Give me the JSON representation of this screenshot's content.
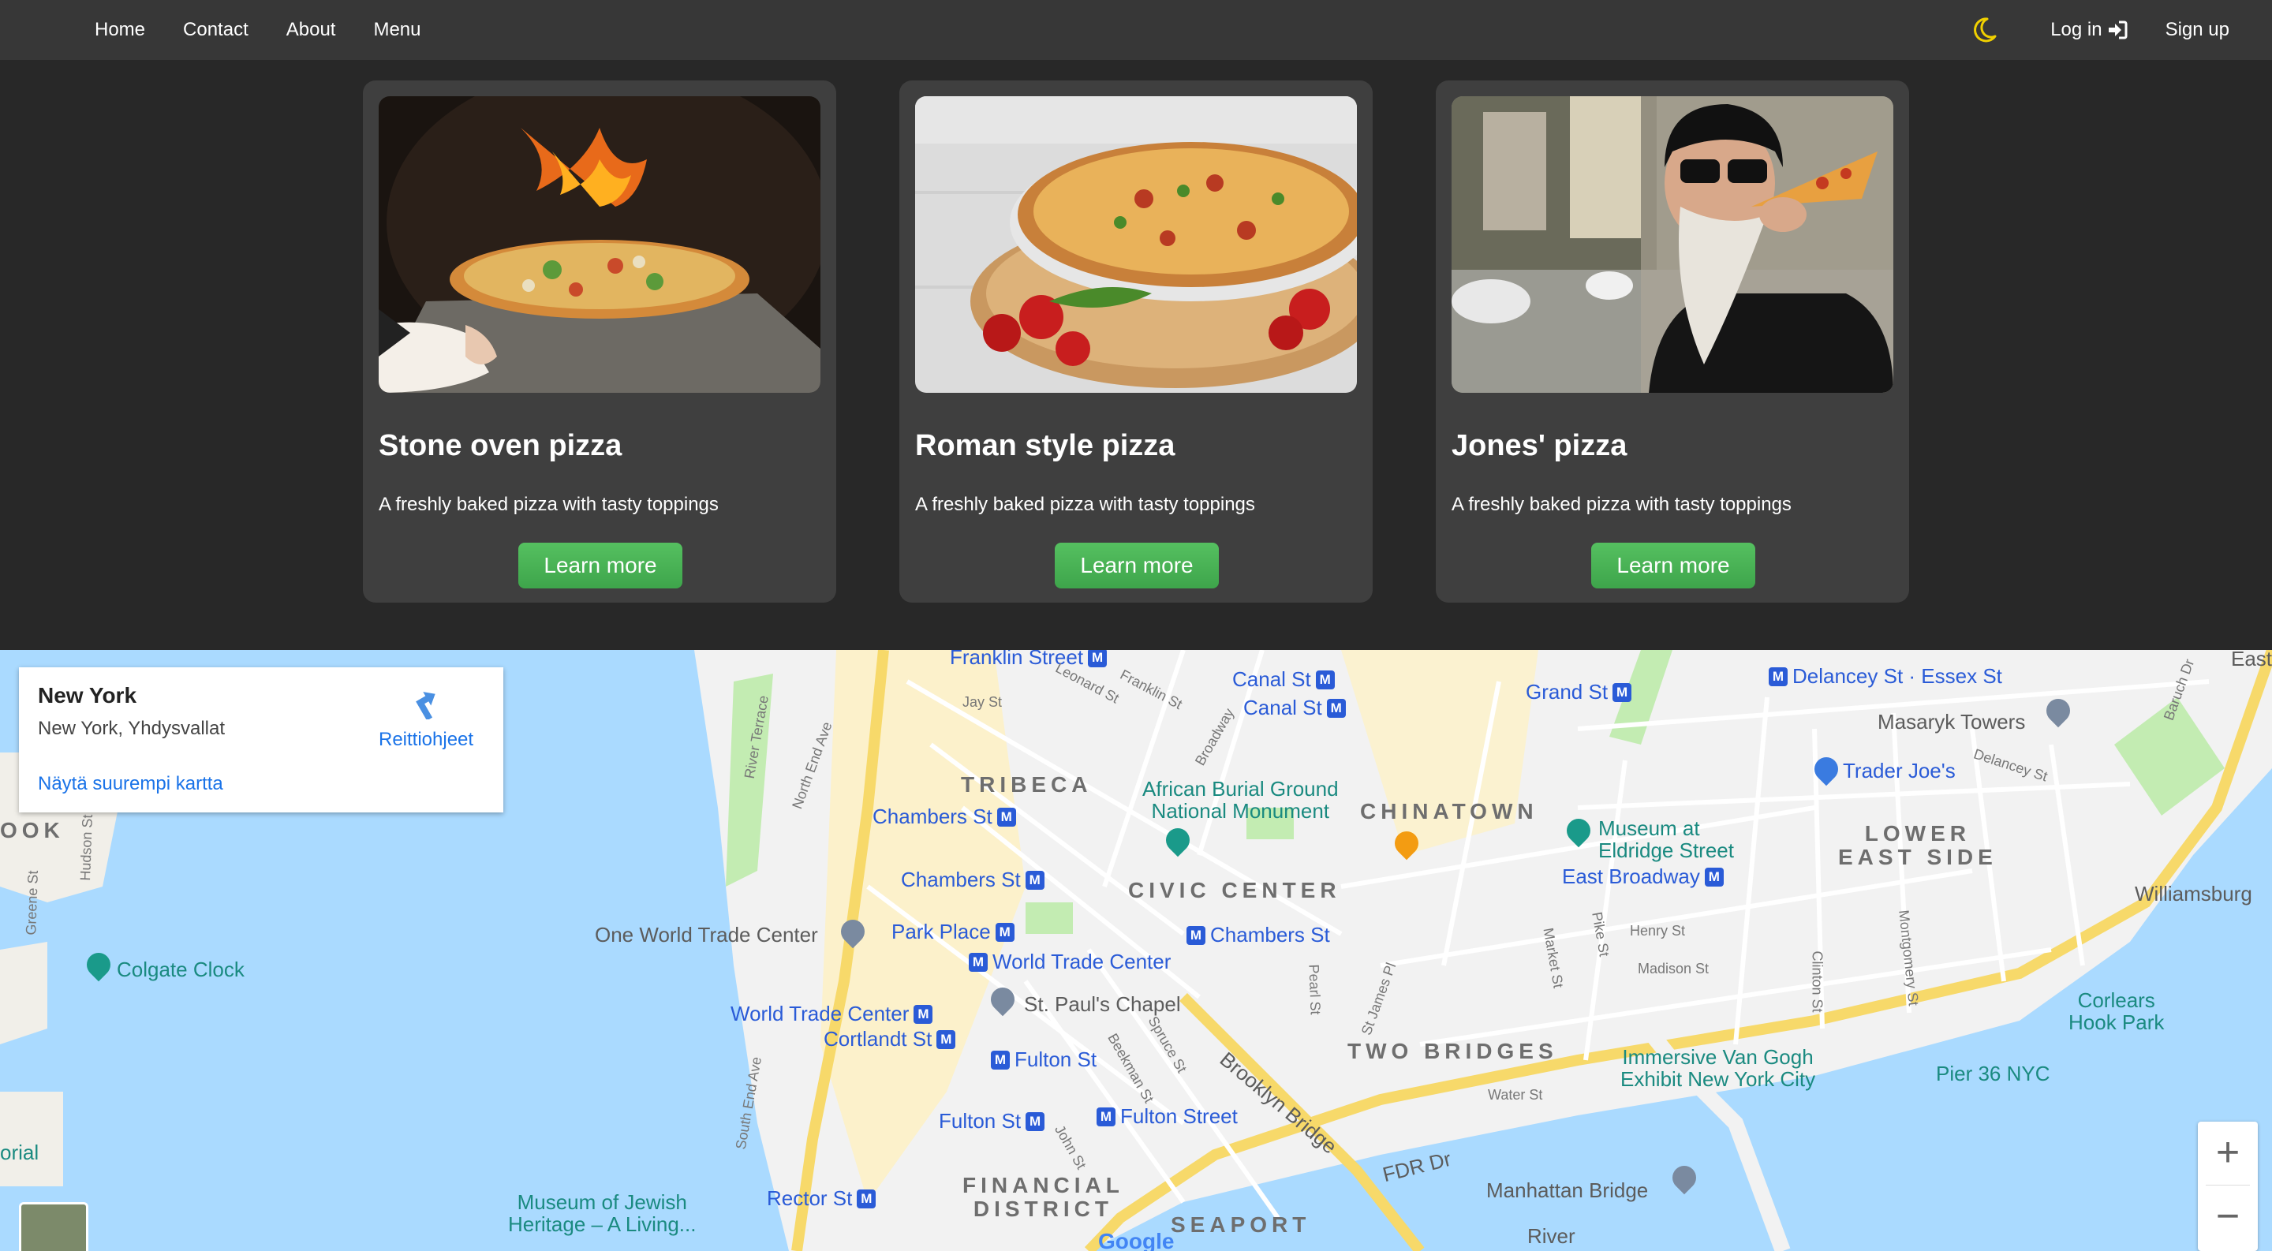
{
  "nav": {
    "links": [
      "Home",
      "Contact",
      "About",
      "Menu"
    ],
    "login": "Log in",
    "signup": "Sign up",
    "theme_icon": "moon-icon",
    "login_icon": "sign-in-icon"
  },
  "cards": [
    {
      "title": "Stone oven pizza",
      "text": "A freshly baked pizza with tasty toppings",
      "button": "Learn more"
    },
    {
      "title": "Roman style pizza",
      "text": "A freshly baked pizza with tasty toppings",
      "button": "Learn more"
    },
    {
      "title": "Jones' pizza",
      "text": "A freshly baked pizza with tasty toppings",
      "button": "Learn more"
    }
  ],
  "colors": {
    "navbar": "#373737",
    "background": "#282828",
    "card": "#3f3f3f",
    "button": "#49b256",
    "moon": "#f0d000",
    "water": "#aadaff",
    "land": "#f2f2f2"
  },
  "map": {
    "info_title": "New York",
    "info_subtitle": "New York, Yhdysvallat",
    "larger_map_link": "Näytä suurempi kartta",
    "directions": "Reittiohjeet",
    "zoom_in": "+",
    "zoom_out": "−",
    "logo": "Google",
    "districts": [
      "TRIBECA",
      "CIVIC CENTER",
      "CHINATOWN",
      "LOWER\nEAST SIDE",
      "TWO BRIDGES",
      "FINANCIAL\nDISTRICT",
      "SEAPORT",
      "OOK"
    ],
    "stations": [
      "Franklin Street",
      "Canal St",
      "Canal St",
      "Grand St",
      "Delancey St · Essex St",
      "Chambers St",
      "Chambers St",
      "Park Place",
      "World Trade Center",
      "Chambers St",
      "World Trade Center",
      "Cortlandt St",
      "Fulton St",
      "Fulton St",
      "Fulton Street",
      "East Broadway",
      "Rector St"
    ],
    "places": [
      "African Burial Ground\nNational Monument",
      "One World Trade Center",
      "St. Paul's Chapel",
      "Colgate Clock",
      "Masaryk Towers",
      "Trader Joe's",
      "Museum at\nEldridge Street",
      "Williamsburg",
      "Corlears\nHook Park",
      "Immersive Van Gogh\nExhibit New York City",
      "Pier 36 NYC",
      "Manhattan Bridge",
      "Brooklyn Bridge",
      "Museum of Jewish\nHeritage – A Living...",
      "orial",
      "FDR Dr",
      "River"
    ],
    "streets": [
      "Leonard St",
      "Franklin St",
      "Broadway",
      "Jay St",
      "River Terrace",
      "North End Ave",
      "Hudson St",
      "Greene St",
      "Henry St",
      "Madison St",
      "Pike St",
      "Market St",
      "Clinton St",
      "Montgomery St",
      "Delancey St",
      "Water St",
      "Pearl St",
      "St James Pl",
      "Spruce St",
      "Beekman St",
      "John St",
      "South End Ave",
      "Baruch Dr",
      "East R"
    ]
  }
}
